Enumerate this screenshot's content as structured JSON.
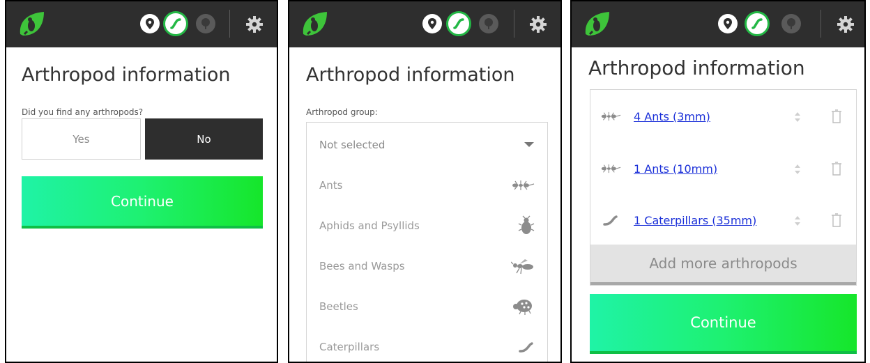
{
  "screens": [
    {
      "title": "Arthropod information",
      "question": "Did you find any arthropods?",
      "yes_label": "Yes",
      "no_label": "No",
      "selected_answer": "No",
      "continue_label": "Continue"
    },
    {
      "title": "Arthropod information",
      "group_label": "Arthropod group:",
      "selected_value": "Not selected",
      "options": [
        {
          "label": "Ants",
          "icon": "ant-icon"
        },
        {
          "label": "Aphids and Psyllids",
          "icon": "aphid-icon"
        },
        {
          "label": "Bees and Wasps",
          "icon": "wasp-icon"
        },
        {
          "label": "Beetles",
          "icon": "beetle-icon"
        },
        {
          "label": "Caterpillars",
          "icon": "caterpillar-icon"
        }
      ]
    },
    {
      "title": "Arthropod information",
      "items": [
        {
          "label": "4 Ants (3mm)",
          "icon": "ant-icon"
        },
        {
          "label": "1 Ants (10mm)",
          "icon": "ant-icon"
        },
        {
          "label": "1 Caterpillars (35mm)",
          "icon": "caterpillar-icon"
        }
      ],
      "add_more_label": "Add more arthropods",
      "continue_label": "Continue"
    }
  ],
  "colors": {
    "topbar": "#2e2e2e",
    "accent_green": "#23b845",
    "link": "#1a2fd8",
    "continue_start": "#1ff3a6",
    "continue_end": "#16e62a"
  }
}
